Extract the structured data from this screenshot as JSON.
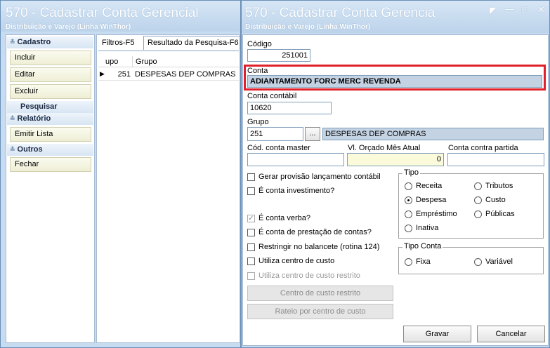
{
  "background_window": {
    "title": "570 - Cadastrar Conta Gerencial",
    "subtitle": "Distribuição e Varejo (Linha WinThor)",
    "sidebar": {
      "groups": [
        {
          "label": "Cadastro",
          "items": [
            "Incluir",
            "Editar",
            "Excluir"
          ]
        },
        {
          "label": "Pesquisar",
          "items": []
        },
        {
          "label": "Relatório",
          "items": [
            "Emitir Lista"
          ]
        },
        {
          "label": "Outros",
          "items": [
            "Fechar"
          ]
        }
      ]
    },
    "tabs": [
      "Filtros-F5",
      "Resultado da Pesquisa-F6"
    ],
    "grid": {
      "columns": [
        "upo",
        "Grupo"
      ],
      "rows": [
        {
          "code": "251",
          "name": "DESPESAS DEP COMPRAS"
        }
      ]
    }
  },
  "dialog": {
    "title": "570 - Cadastrar Conta Gerencia",
    "subtitle": "Distribuição e Varejo (Linha WinThor)",
    "fields": {
      "codigo_label": "Código",
      "codigo_value": "251001",
      "conta_label": "Conta",
      "conta_value": "ADIANTAMENTO FORC MERC REVENDA",
      "conta_contabil_label": "Conta contábil",
      "conta_contabil_value": "10620",
      "grupo_label": "Grupo",
      "grupo_code": "251",
      "grupo_lookup_label": "...",
      "grupo_name": "DESPESAS DEP COMPRAS",
      "cod_master_label": "Cód. conta master",
      "cod_master_value": "",
      "vl_orcado_label": "Vl. Orçado Mês Atual",
      "vl_orcado_value": "0",
      "contra_partida_label": "Conta contra partida",
      "contra_partida_value": ""
    },
    "checkboxes": [
      {
        "label": "Gerar provisão lançamento contábil",
        "checked": false,
        "enabled": true
      },
      {
        "label": "É conta investimento?",
        "checked": false,
        "enabled": true
      },
      {
        "label": "É conta verba?",
        "checked": true,
        "enabled": false
      },
      {
        "label": "É conta de prestação de contas?",
        "checked": false,
        "enabled": true
      },
      {
        "label": "Restringir no balancete (rotina 124)",
        "checked": false,
        "enabled": true
      },
      {
        "label": "Utiliza centro de custo",
        "checked": false,
        "enabled": true
      },
      {
        "label": "Utiliza centro de custo restrito",
        "checked": false,
        "enabled": false
      }
    ],
    "tipo": {
      "label": "Tipo",
      "options": [
        "Receita",
        "Tributos",
        "Despesa",
        "Custo",
        "Empréstimo",
        "Públicas",
        "Inativa"
      ],
      "selected": "Despesa"
    },
    "tipo_conta": {
      "label": "Tipo Conta",
      "options": [
        "Fixa",
        "Variável"
      ]
    },
    "buttons": {
      "centro_custo_restrito": "Centro de custo restrito",
      "rateio": "Rateio por centro de custo",
      "gravar": "Gravar",
      "cancelar": "Cancelar"
    }
  },
  "colors": {
    "highlight_border": "#e0202a",
    "readonly_field": "#c4d3e4",
    "yellow_field": "#fbfbdc"
  }
}
